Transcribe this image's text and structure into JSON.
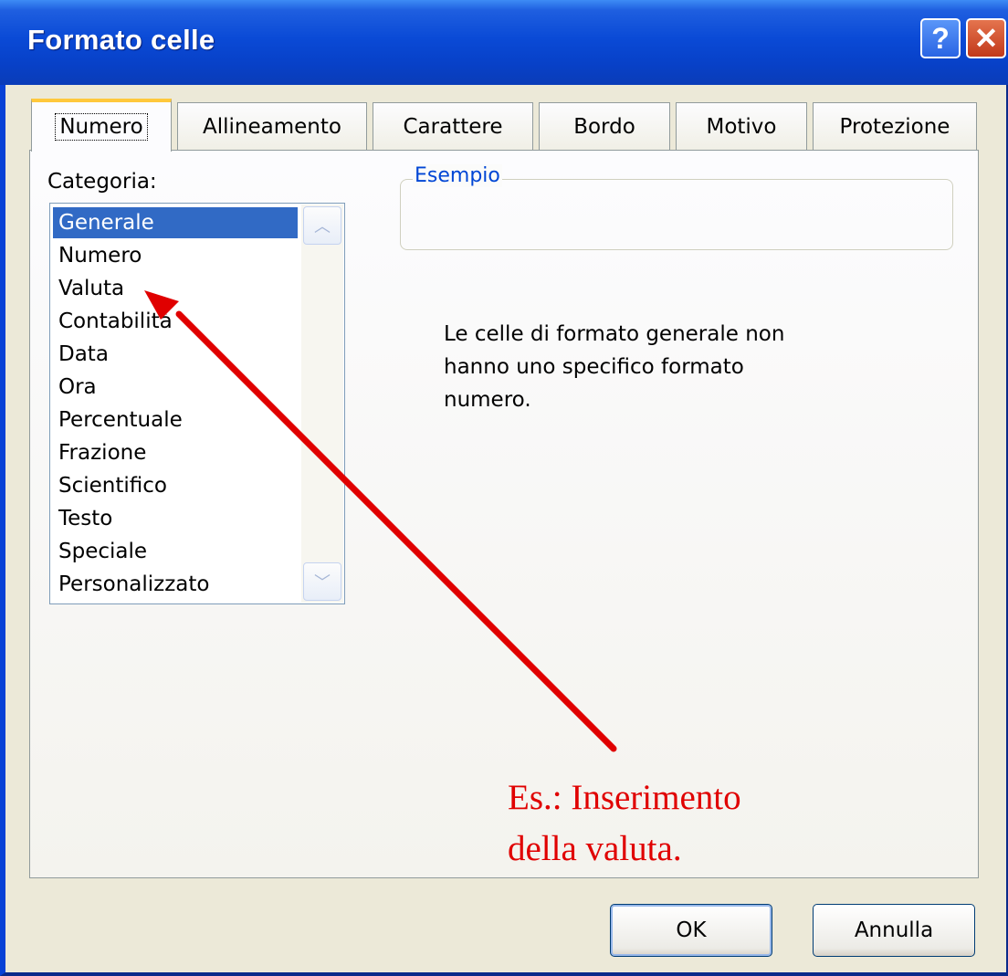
{
  "window": {
    "title": "Formato celle",
    "help_symbol": "?",
    "close_symbol": "✕"
  },
  "tabs": [
    {
      "label": "Numero",
      "active": true
    },
    {
      "label": "Allineamento"
    },
    {
      "label": "Carattere"
    },
    {
      "label": "Bordo"
    },
    {
      "label": "Motivo"
    },
    {
      "label": "Protezione"
    }
  ],
  "category": {
    "label": "Categoria:",
    "selected": "Generale",
    "items": [
      "Generale",
      "Numero",
      "Valuta",
      "Contabilità",
      "Data",
      "Ora",
      "Percentuale",
      "Frazione",
      "Scientifico",
      "Testo",
      "Speciale",
      "Personalizzato"
    ]
  },
  "sample": {
    "label": "Esempio"
  },
  "description": "Le celle di formato generale non\nhanno uno specifico formato\nnumero.",
  "annotation": {
    "text": "Es.: Inserimento\ndella valuta.",
    "color": "#e00000"
  },
  "buttons": {
    "ok": "OK",
    "cancel": "Annulla"
  },
  "colors": {
    "title_bar": "#0a4ad6",
    "selection": "#316ac5",
    "dialog_bg": "#ece9d8"
  }
}
